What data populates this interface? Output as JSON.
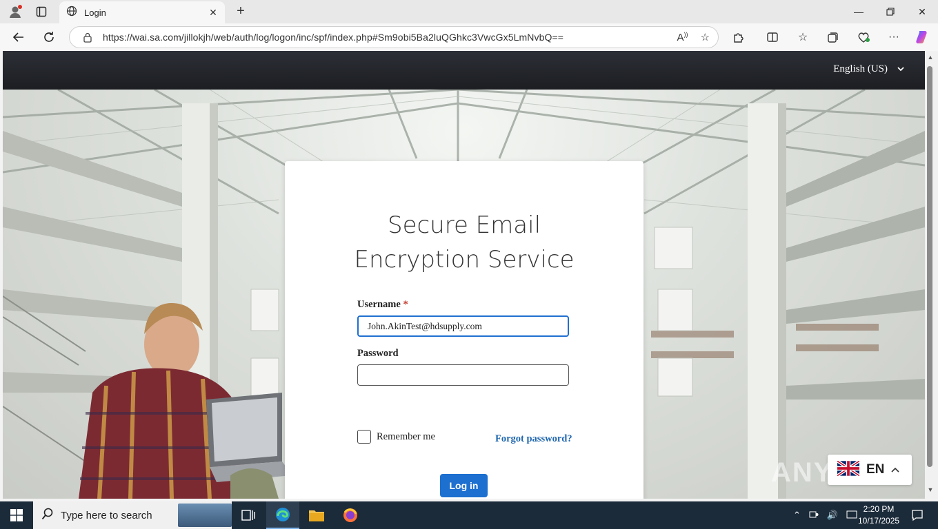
{
  "browser": {
    "tab_title": "Login",
    "url": "https://wai.sa.com/jillokjh/web/auth/log/logon/inc/spf/index.php#Sm9obi5Ba2luQGhkc3VwcGx5LmNvbQ==",
    "icons": [
      "profile-icon",
      "tab-actions-icon",
      "globe-icon",
      "close-icon",
      "new-tab-icon",
      "back-icon",
      "refresh-icon",
      "lock-icon",
      "read-aloud-icon",
      "favorite-star-icon",
      "extensions-icon",
      "split-screen-icon",
      "favorites-icon",
      "collections-icon",
      "performance-icon",
      "more-icon",
      "copilot-icon"
    ]
  },
  "page": {
    "language_selector": "English (US)",
    "title_line1": "Secure Email",
    "title_line2": "Encryption Service",
    "username_label": "Username",
    "username_required": "*",
    "username_value": "John.AkinTest@hdsupply.com",
    "password_label": "Password",
    "password_value": "",
    "remember_label": "Remember me",
    "forgot_label": "Forgot password?",
    "login_label": "Log in",
    "lang_float_label": "EN",
    "watermark": "ANY.RUN"
  },
  "taskbar": {
    "search_placeholder": "Type here to search",
    "time": "2:20 PM",
    "date": "10/17/2025"
  },
  "colors": {
    "accent_blue": "#1d6fd0",
    "link_blue": "#2067b0",
    "header_dark": "#1c1e22",
    "taskbar": "#1c2b3a"
  }
}
